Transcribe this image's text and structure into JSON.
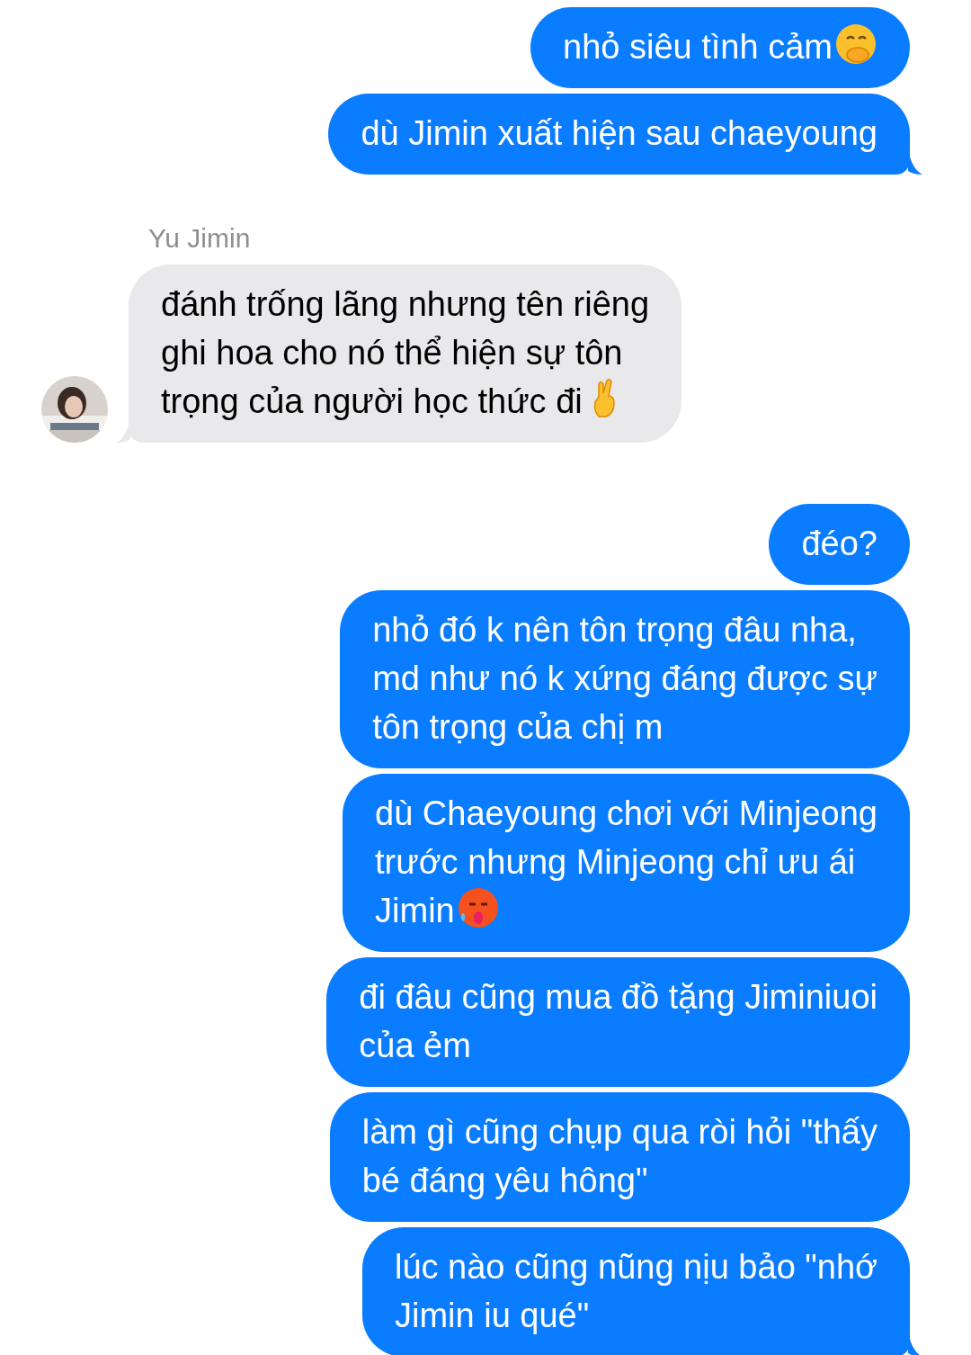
{
  "messages": [
    {
      "kind": "sent",
      "text": "nhỏ siêu tình cảm",
      "emoji": true,
      "tail": false
    },
    {
      "kind": "sent",
      "text": "dù Jimin xuất hiện sau chaeyoung",
      "tail": true
    },
    {
      "kind": "sender_name",
      "text": "Yu Jimin"
    },
    {
      "kind": "received",
      "text": "đánh trống lãng nhưng tên riêng\nghi hoa cho nó thể hiện sự tôn\ntrọng của người học thức đi",
      "emoji": true,
      "tail": true
    },
    {
      "kind": "sent",
      "text": "đéo?",
      "tail": false
    },
    {
      "kind": "sent",
      "text": "nhỏ đó k nên tôn trọng đâu nha,\nmd như nó k xứng đáng được sự\ntôn trọng của chị m",
      "tail": false
    },
    {
      "kind": "sent",
      "text": "dù Chaeyoung chơi với Minjeong\ntrước nhưng Minjeong chỉ ưu ái\nJimin",
      "emoji": true,
      "tail": false
    },
    {
      "kind": "sent",
      "text": "đi đâu cũng mua đồ tặng Jiminiuoi\ncủa ẻm",
      "tail": false
    },
    {
      "kind": "sent",
      "text": "làm gì cũng chụp qua ròi hỏi \"thấy\nbé đáng yêu hông\"",
      "tail": false
    },
    {
      "kind": "sent",
      "text": "lúc nào cũng nũng nịu bảo \"nhớ\nJimin iu qué\"",
      "tail": true
    }
  ]
}
